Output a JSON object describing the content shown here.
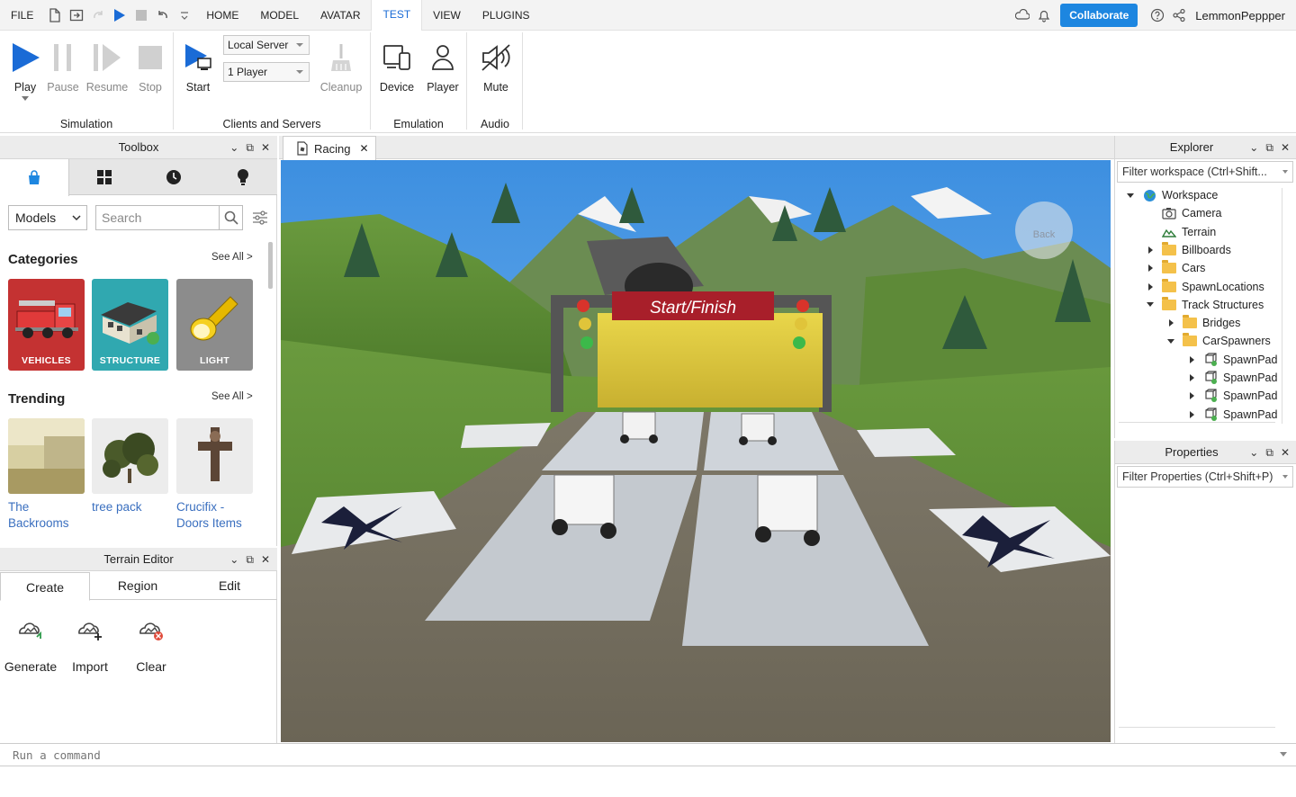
{
  "menu": {
    "items": [
      "FILE",
      "HOME",
      "MODEL",
      "AVATAR",
      "TEST",
      "VIEW",
      "PLUGINS"
    ],
    "active": "TEST",
    "collaborate_label": "Collaborate",
    "username": "LemmonPeppper",
    "accent_color": "#1d86e0"
  },
  "ribbon": {
    "simulation": {
      "title": "Simulation",
      "play": "Play",
      "pause": "Pause",
      "resume": "Resume",
      "stop": "Stop"
    },
    "clients": {
      "title": "Clients and Servers",
      "start": "Start",
      "server_mode": "Local Server",
      "players": "1 Player",
      "cleanup": "Cleanup"
    },
    "emulation": {
      "title": "Emulation",
      "device": "Device",
      "player": "Player"
    },
    "audio": {
      "title": "Audio",
      "mute": "Mute"
    }
  },
  "toolbox": {
    "title": "Toolbox",
    "category_select": "Models",
    "search_placeholder": "Search",
    "categories_title": "Categories",
    "see_all": "See All >",
    "categories": [
      "VEHICLES",
      "STRUCTURE",
      "LIGHT"
    ],
    "trending_title": "Trending",
    "trending": [
      {
        "name": "The Backrooms"
      },
      {
        "name": "tree pack"
      },
      {
        "name": "Crucifix - Doors Items"
      }
    ]
  },
  "terrain": {
    "title": "Terrain Editor",
    "tabs": [
      "Create",
      "Region",
      "Edit"
    ],
    "active_tab": "Create",
    "tools": [
      "Generate",
      "Import",
      "Clear"
    ]
  },
  "document": {
    "tab_name": "Racing"
  },
  "viewport": {
    "banner": "Start/Finish",
    "back_label": "Back"
  },
  "explorer": {
    "title": "Explorer",
    "filter_placeholder": "Filter workspace (Ctrl+Shift...",
    "tree": [
      {
        "label": "Workspace",
        "depth": 0,
        "expand": "down",
        "icon": "globe-icon"
      },
      {
        "label": "Camera",
        "depth": 1,
        "expand": "none",
        "icon": "camera-icon"
      },
      {
        "label": "Terrain",
        "depth": 1,
        "expand": "none",
        "icon": "terrain-icon"
      },
      {
        "label": "Billboards",
        "depth": 1,
        "expand": "right",
        "icon": "folder-icon"
      },
      {
        "label": "Cars",
        "depth": 1,
        "expand": "right",
        "icon": "folder-icon"
      },
      {
        "label": "SpawnLocations",
        "depth": 1,
        "expand": "right",
        "icon": "folder-icon"
      },
      {
        "label": "Track Structures",
        "depth": 1,
        "expand": "down",
        "icon": "folder-icon"
      },
      {
        "label": "Bridges",
        "depth": 2,
        "expand": "right",
        "icon": "folder-icon"
      },
      {
        "label": "CarSpawners",
        "depth": 2,
        "expand": "down",
        "icon": "folder-icon"
      },
      {
        "label": "SpawnPad",
        "depth": 3,
        "expand": "right",
        "icon": "model-icon"
      },
      {
        "label": "SpawnPad",
        "depth": 3,
        "expand": "right",
        "icon": "model-icon"
      },
      {
        "label": "SpawnPad",
        "depth": 3,
        "expand": "right",
        "icon": "model-icon"
      },
      {
        "label": "SpawnPad",
        "depth": 3,
        "expand": "right",
        "icon": "model-icon"
      }
    ]
  },
  "properties": {
    "title": "Properties",
    "filter_placeholder": "Filter Properties (Ctrl+Shift+P)"
  },
  "command": {
    "placeholder": "Run a command"
  }
}
